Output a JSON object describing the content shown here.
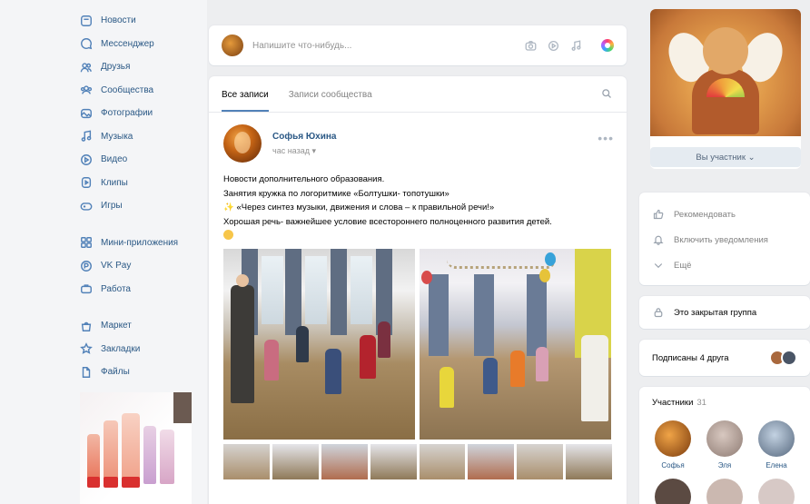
{
  "sidebar": {
    "items": [
      {
        "label": "Новости",
        "icon": "news-icon"
      },
      {
        "label": "Мессенджер",
        "icon": "messenger-icon"
      },
      {
        "label": "Друзья",
        "icon": "friends-icon"
      },
      {
        "label": "Сообщества",
        "icon": "communities-icon"
      },
      {
        "label": "Фотографии",
        "icon": "photos-icon"
      },
      {
        "label": "Музыка",
        "icon": "music-icon"
      },
      {
        "label": "Видео",
        "icon": "video-icon"
      },
      {
        "label": "Клипы",
        "icon": "clips-icon"
      },
      {
        "label": "Игры",
        "icon": "games-icon"
      }
    ],
    "items2": [
      {
        "label": "Мини-приложения",
        "icon": "mini-apps-icon"
      },
      {
        "label": "VK Pay",
        "icon": "vk-pay-icon"
      },
      {
        "label": "Работа",
        "icon": "work-icon"
      }
    ],
    "items3": [
      {
        "label": "Маркет",
        "icon": "market-icon"
      },
      {
        "label": "Закладки",
        "icon": "bookmarks-icon"
      },
      {
        "label": "Файлы",
        "icon": "files-icon"
      }
    ]
  },
  "composer": {
    "placeholder": "Напишите что-нибудь..."
  },
  "feed": {
    "tabs": [
      "Все записи",
      "Записи сообщества"
    ],
    "active_tab": 0
  },
  "post": {
    "author": "Софья Юхина",
    "time": "час назад",
    "line1": "Новости дополнительного образования.",
    "line2": "Занятия кружка по логоритмике «Болтушки- топотушки»",
    "line3": "«Через синтез музыки, движения и слова – к правильной речи!»",
    "line4": "Хорошая речь- важнейшее условие всестороннего полноценного развития детей."
  },
  "group": {
    "join_label": "Вы участник"
  },
  "actions": [
    {
      "label": "Рекомендовать",
      "icon": "like-icon"
    },
    {
      "label": "Включить уведомления",
      "icon": "bell-icon"
    },
    {
      "label": "Ещё",
      "icon": "chevron-down-icon"
    }
  ],
  "closed_group": "Это закрытая группа",
  "friends_subscribed": "Подписаны 4 друга",
  "members": {
    "title": "Участники",
    "count": "31",
    "list": [
      {
        "name": "Софья",
        "color": "#c06b22"
      },
      {
        "name": "Эля",
        "color": "#9a8a84"
      },
      {
        "name": "Елена",
        "color": "#7d92a8"
      }
    ]
  },
  "colors": {
    "link": "#2a5885",
    "accent": "#5181b8",
    "background": "#edeef0"
  }
}
